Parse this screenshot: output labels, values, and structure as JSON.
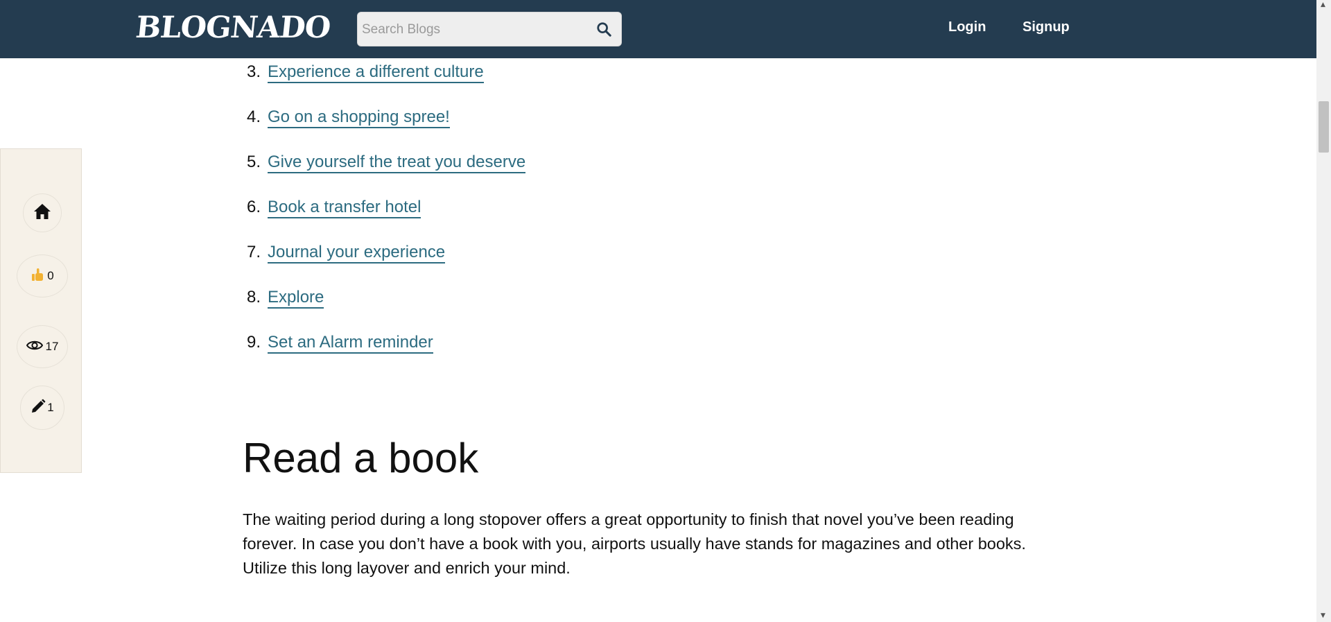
{
  "header": {
    "logo_text": "BLOGNADO",
    "search": {
      "placeholder": "Search Blogs",
      "value": ""
    },
    "nav": {
      "login": "Login",
      "signup": "Signup"
    },
    "colors": {
      "bar": "#243c50",
      "text": "#ffffff"
    }
  },
  "sidebar": {
    "home_icon": "home-icon",
    "likes": {
      "icon": "thumbs-up-icon",
      "count": "0"
    },
    "views": {
      "icon": "eye-icon",
      "count": "17"
    },
    "edits": {
      "icon": "pencil-icon",
      "count": "1"
    }
  },
  "article": {
    "steps": [
      {
        "num": "3.",
        "label": "Experience a different culture"
      },
      {
        "num": "4.",
        "label": "Go on a shopping spree!"
      },
      {
        "num": "5.",
        "label": "Give yourself the treat you deserve"
      },
      {
        "num": "6.",
        "label": "Book a transfer hotel"
      },
      {
        "num": "7.",
        "label": "Journal your experience"
      },
      {
        "num": "8.",
        "label": "Explore"
      },
      {
        "num": "9.",
        "label": "Set an Alarm reminder"
      }
    ],
    "section_title": "Read a book",
    "section_body": "The waiting period during a long stopover offers a great opportunity to finish that novel you’ve been reading forever. In case you don’t have a book with you, airports usually have stands for magazines and other books. Utilize this long layover and enrich your mind.",
    "link_color": "#2c6b80"
  }
}
